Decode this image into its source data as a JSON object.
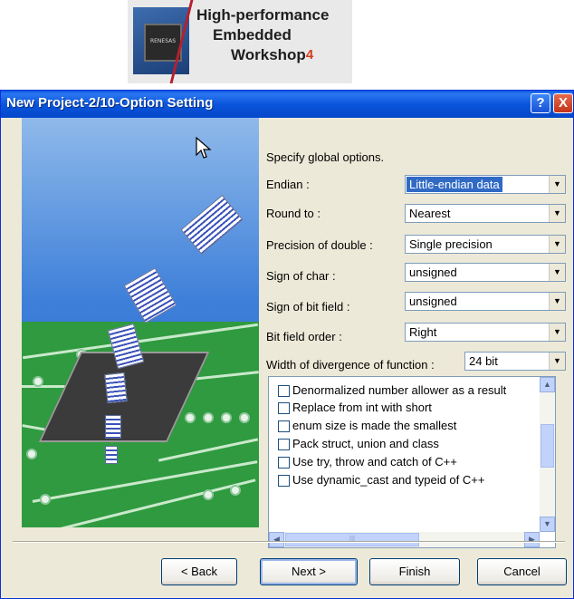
{
  "banner": {
    "line1": "High-performance",
    "line2": "Embedded",
    "line3": "Workshop",
    "superscript": "4",
    "chip_brand": "RENESAS"
  },
  "window": {
    "title": "New Project-2/10-Option Setting",
    "help_label": "?",
    "close_label": "X"
  },
  "form": {
    "intro": "Specify global options.",
    "fields": [
      {
        "label": "Endian :",
        "value": "Little-endian data"
      },
      {
        "label": "Round to :",
        "value": "Nearest"
      },
      {
        "label": "Precision of double :",
        "value": "Single precision"
      },
      {
        "label": "Sign of char :",
        "value": "unsigned"
      },
      {
        "label": "Sign of bit field :",
        "value": "unsigned"
      },
      {
        "label": "Bit field order :",
        "value": "Right"
      },
      {
        "label": "Width of divergence of function :",
        "value": "24 bit"
      }
    ]
  },
  "options_list": [
    {
      "label": "Denormalized number allower as a result",
      "checked": false
    },
    {
      "label": "Replace from int with short",
      "checked": false
    },
    {
      "label": "enum size is made the smallest",
      "checked": false
    },
    {
      "label": "Pack struct, union and class",
      "checked": false
    },
    {
      "label": "Use try, throw and catch of C++",
      "checked": false
    },
    {
      "label": "Use dynamic_cast and typeid of C++",
      "checked": false
    }
  ],
  "buttons": {
    "back": "< Back",
    "next": "Next >",
    "finish": "Finish",
    "cancel": "Cancel"
  },
  "colors": {
    "titlebar": "#0a55dc",
    "selection": "#316ac5",
    "dialog_bg": "#ece9d8"
  }
}
